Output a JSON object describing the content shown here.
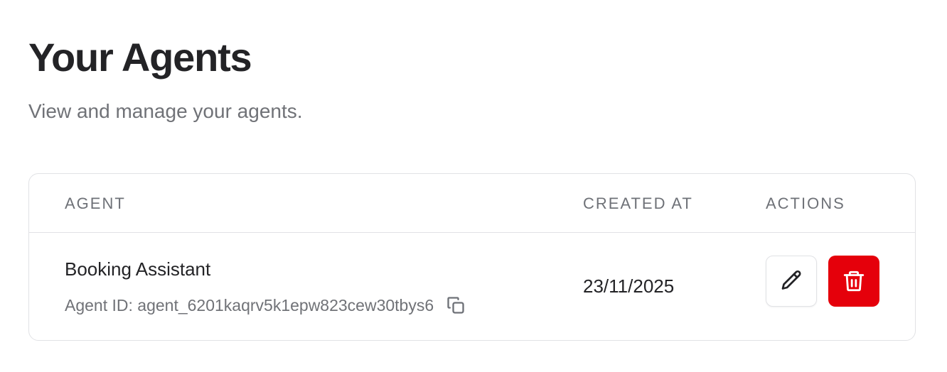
{
  "header": {
    "title": "Your Agents",
    "subtitle": "View and manage your agents."
  },
  "table": {
    "columns": [
      "AGENT",
      "CREATED AT",
      "ACTIONS"
    ],
    "rows": [
      {
        "name": "Booking Assistant",
        "agent_id": "Agent ID: agent_6201kaqrv5k1epw823cew30tbys6",
        "created_at": "23/11/2025",
        "actions": [
          {
            "icon": "pencil-icon"
          },
          {
            "icon": "trash-icon"
          }
        ]
      }
    ]
  },
  "colors": {
    "delete_button": "#e5000b",
    "header_text": "#6e7177",
    "border": "#e1e2e5",
    "title": "#232326"
  },
  "icons": {
    "copy": "copy-icon",
    "edit": "pencil-icon",
    "delete": "trash-icon"
  }
}
